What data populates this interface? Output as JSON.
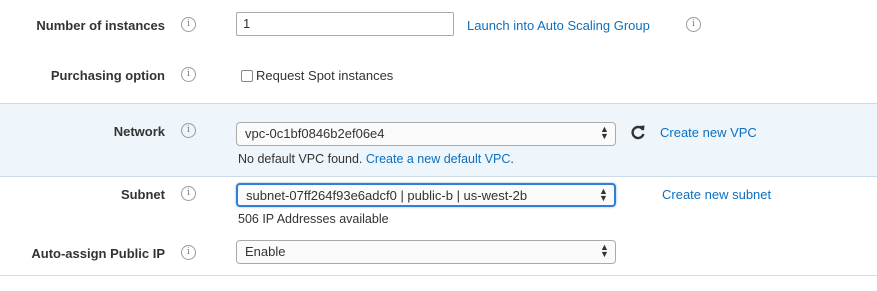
{
  "rows": {
    "instances": {
      "label": "Number of instances",
      "value": "1",
      "asg_link": "Launch into Auto Scaling Group"
    },
    "purchasing": {
      "label": "Purchasing option",
      "checkbox_label": "Request Spot instances",
      "checked": false
    },
    "network": {
      "label": "Network",
      "selected": "vpc-0c1bf0846b2ef06e4",
      "refresh_icon": "refresh-icon",
      "create_link": "Create new VPC",
      "note_prefix": "No default VPC found.",
      "note_link": "Create a new default VPC",
      "note_suffix": "."
    },
    "subnet": {
      "label": "Subnet",
      "selected": "subnet-07ff264f93e6adcf0 | public-b | us-west-2b",
      "create_link": "Create new subnet",
      "available": "506 IP Addresses available"
    },
    "public_ip": {
      "label": "Auto-assign Public IP",
      "selected": "Enable"
    }
  },
  "info_glyph": "i",
  "colors": {
    "link": "#0d6fbf",
    "highlight_bg": "#eef6fb",
    "focus_border": "#2f7fd8"
  }
}
